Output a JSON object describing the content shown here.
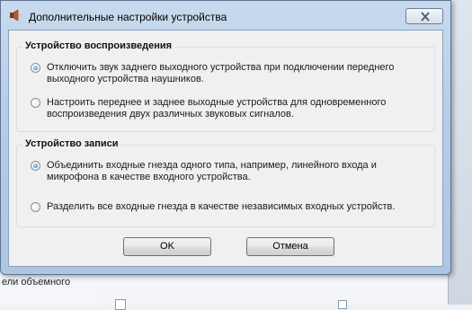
{
  "background": {
    "sidebar_fragment": "ели объемного"
  },
  "dialog": {
    "title": "Дополнительные настройки устройства",
    "icons": {
      "title": "speaker-icon",
      "close": "close-icon"
    },
    "groups": [
      {
        "title": "Устройство воспроизведения",
        "options": [
          {
            "label": "Отключить звук заднего выходного устройства при подключении переднего выходного устройства наушников.",
            "checked": true
          },
          {
            "label": "Настроить переднее и заднее выходные устройства для одновременного воспроизведения двух различных звуковых сигналов.",
            "checked": false
          }
        ]
      },
      {
        "title": "Устройство записи",
        "options": [
          {
            "label": "Объединить входные гнезда одного типа, например, линейного входа и микрофона в качестве входного устройства.",
            "checked": true
          },
          {
            "label": "Разделить все входные гнезда в качестве независимых входных устройств.",
            "checked": false
          }
        ]
      }
    ],
    "buttons": {
      "ok": "OK",
      "cancel": "Отмена"
    }
  },
  "colors": {
    "title_bar": "#c9daee",
    "radio_checked": "#4a9ad8",
    "client_bg": "#f0f0f0"
  }
}
